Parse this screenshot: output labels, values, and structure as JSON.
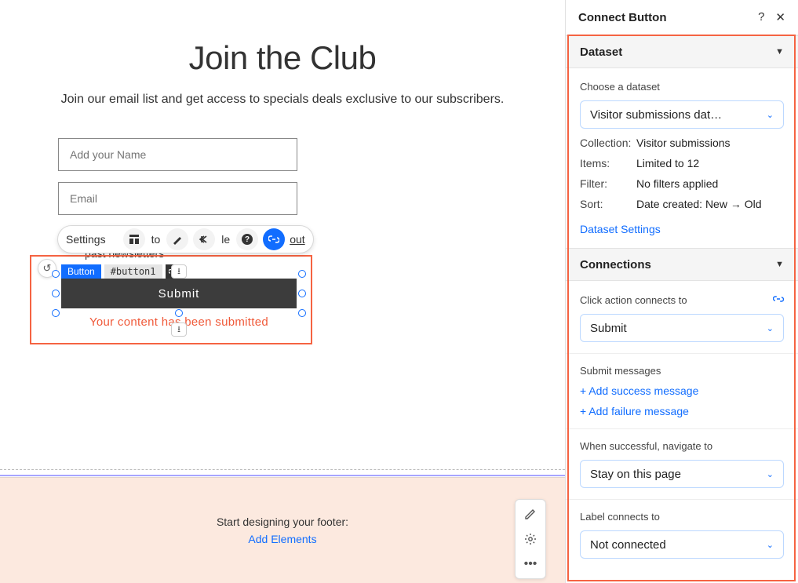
{
  "page": {
    "title": "Join the Club",
    "subtitle": "Join our email list and get access to specials deals exclusive to our subscribers."
  },
  "form": {
    "name_placeholder": "Add your Name",
    "email_placeholder": "Email",
    "checkbox_fragment": "past newsletters",
    "submit_label": "Submit",
    "overlay_message": "Your content has been submitted"
  },
  "toolbar": {
    "settings": "Settings",
    "fragment1": "to",
    "fragment2": "le",
    "fragment3": "out"
  },
  "element": {
    "tag": "Button",
    "id": "#button1"
  },
  "footer": {
    "text": "Start designing your footer:",
    "link": "Add Elements"
  },
  "panel": {
    "title": "Connect Button",
    "dataset_section": "Dataset",
    "choose_dataset_label": "Choose a dataset",
    "dataset_value": "Visitor submissions dat…",
    "collection_k": "Collection:",
    "collection_v": "Visitor submissions",
    "items_k": "Items:",
    "items_v": "Limited to 12",
    "filter_k": "Filter:",
    "filter_v": "No filters applied",
    "sort_k": "Sort:",
    "sort_v": "Date created: New → Old",
    "dataset_settings": "Dataset Settings",
    "connections_section": "Connections",
    "click_action_label": "Click action connects to",
    "click_action_value": "Submit",
    "submit_messages": "Submit messages",
    "add_success": "+ Add success message",
    "add_failure": "+ Add failure message",
    "when_successful_label": "When successful, navigate to",
    "when_successful_value": "Stay on this page",
    "label_connects_label": "Label connects to",
    "label_connects_value": "Not connected"
  }
}
